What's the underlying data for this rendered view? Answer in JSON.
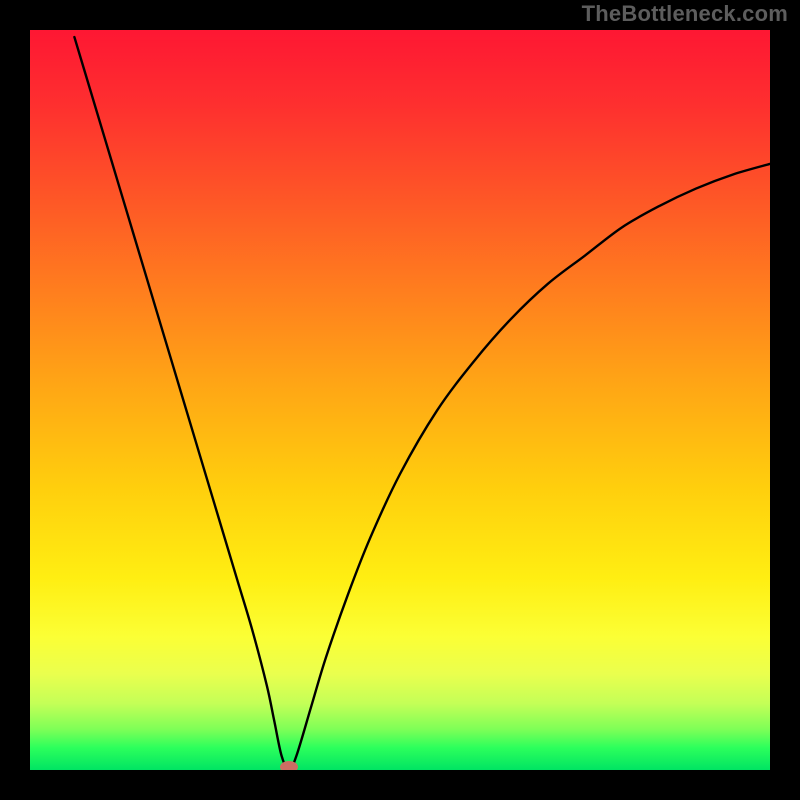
{
  "watermark": "TheBottleneck.com",
  "chart_data": {
    "type": "line",
    "title": "",
    "xlabel": "",
    "ylabel": "",
    "xlim": [
      0,
      100
    ],
    "ylim": [
      0,
      105
    ],
    "legend": false,
    "grid": false,
    "series": [
      {
        "name": "curve",
        "x": [
          6,
          8,
          10,
          12,
          14,
          16,
          18,
          20,
          22,
          24,
          26,
          28,
          30,
          32,
          33,
          34,
          35,
          36,
          38,
          40,
          43,
          46,
          50,
          55,
          60,
          65,
          70,
          75,
          80,
          85,
          90,
          95,
          100
        ],
        "y": [
          104,
          97,
          90,
          83,
          76,
          69,
          62,
          55,
          48,
          41,
          34,
          27,
          20,
          12,
          7,
          2,
          0,
          2,
          9,
          16,
          25,
          33,
          42,
          51,
          58,
          64,
          69,
          73,
          77,
          80,
          82.5,
          84.5,
          86
        ]
      }
    ],
    "marker": {
      "x": 35,
      "y": 0,
      "color": "#cc6d63",
      "rx": 9,
      "ry": 6
    },
    "background_gradient": {
      "top": "#fe1733",
      "mid": "#ffee12",
      "bottom": "#00e463"
    },
    "frame_color": "#000000"
  }
}
